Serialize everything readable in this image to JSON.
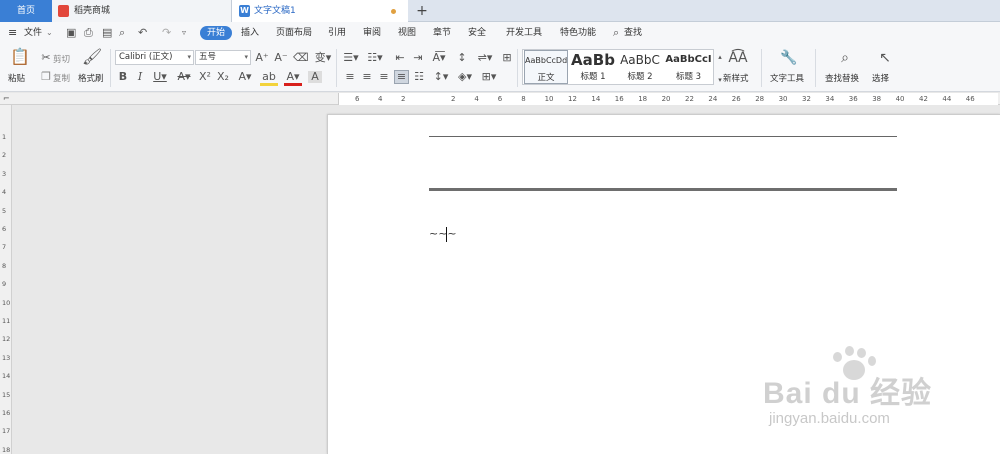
{
  "tabs": {
    "home": "首页",
    "mall": "稻壳商城",
    "doc": "文字文稿1",
    "new": "+",
    "doc_icon": "W"
  },
  "menu": {
    "file": "文件",
    "items": [
      "开始",
      "插入",
      "页面布局",
      "引用",
      "审阅",
      "视图",
      "章节",
      "安全",
      "开发工具",
      "特色功能"
    ],
    "search": "查找"
  },
  "ribbon": {
    "paste": "粘贴",
    "cut": "剪切",
    "copy": "复制",
    "format_painter": "格式刷",
    "font_name": "Calibri (正文)",
    "font_size": "五号",
    "styles": [
      {
        "preview": "AaBbCcDd",
        "name": "正文"
      },
      {
        "preview": "AaBb",
        "name": "标题 1"
      },
      {
        "preview": "AaBbC",
        "name": "标题 2"
      },
      {
        "preview": "AaBbCcI",
        "name": "标题 3"
      }
    ],
    "new_style": "新样式",
    "text_tools": "文字工具",
    "find_replace": "查找替换",
    "select": "选择"
  },
  "ruler": {
    "h_left": [
      "6",
      "4",
      "2"
    ],
    "h_main": [
      "2",
      "4",
      "6",
      "8",
      "10",
      "12",
      "14",
      "16",
      "18",
      "20",
      "22",
      "24",
      "26",
      "28",
      "30",
      "32",
      "34",
      "36",
      "38",
      "40",
      "42",
      "44",
      "46"
    ],
    "v": [
      "1",
      "2",
      "3",
      "4",
      "5",
      "6",
      "7",
      "8",
      "9",
      "10",
      "11",
      "12",
      "13",
      "14",
      "15",
      "16",
      "17",
      "18"
    ]
  },
  "document": {
    "text": "~~~"
  },
  "watermark": {
    "brand": "Bai du 经验",
    "url": "jingyan.baidu.com"
  },
  "colors": {
    "accent": "#3a7fd5",
    "highlight": "#f3d33c",
    "font_color": "#d8201c"
  }
}
